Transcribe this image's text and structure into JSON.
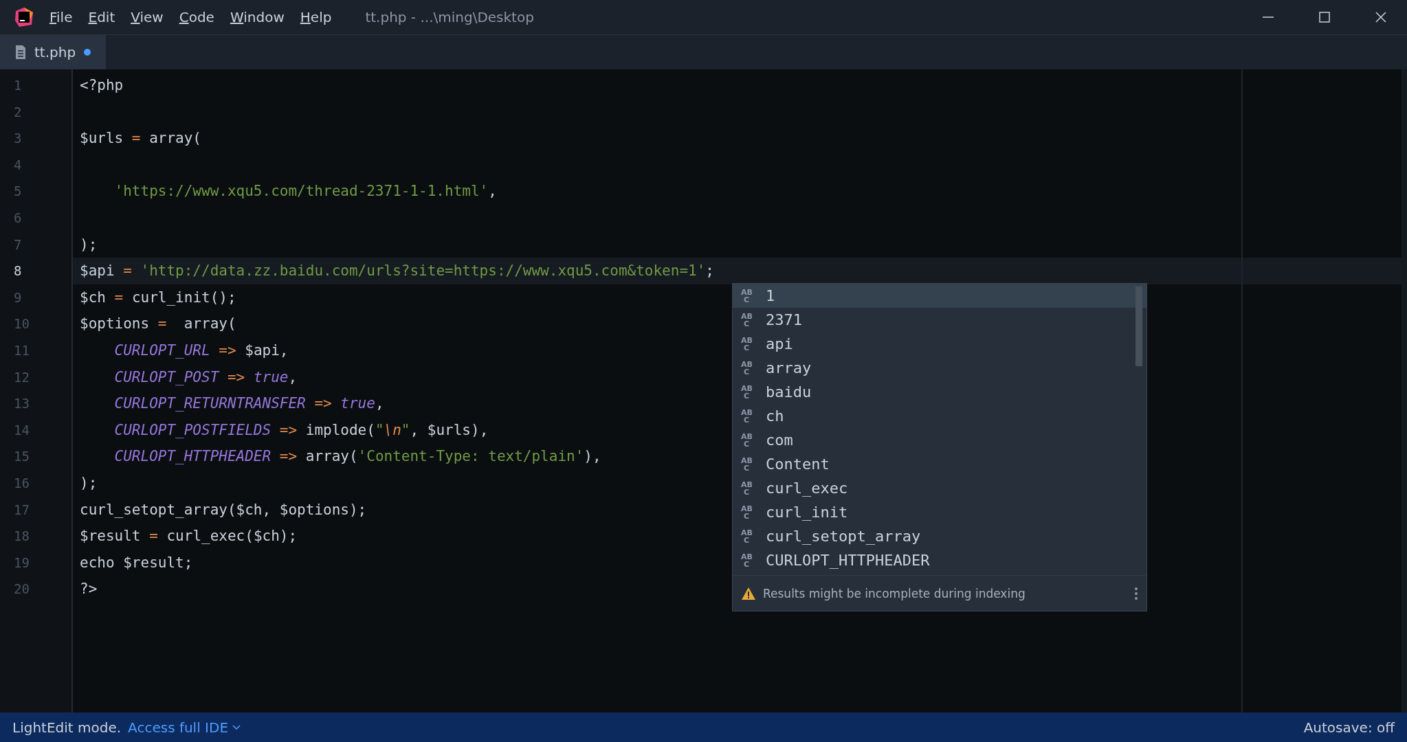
{
  "menu_bar": {
    "items": [
      "File",
      "Edit",
      "View",
      "Code",
      "Window",
      "Help"
    ],
    "title": "tt.php - ...\\ming\\Desktop"
  },
  "tabs": [
    {
      "label": "tt.php",
      "selected": true,
      "modified": true
    }
  ],
  "editor": {
    "lines": [
      {
        "number": "1",
        "current": false,
        "tokens": [
          {
            "kind": "plain",
            "text": "<?php"
          }
        ]
      },
      {
        "number": "2",
        "current": false
      },
      {
        "number": "3",
        "current": false,
        "tokens": [
          {
            "kind": "plain",
            "text": "$urls"
          },
          {
            "kind": "op",
            "text": " = "
          },
          {
            "kind": "plain",
            "text": "array("
          }
        ]
      },
      {
        "number": "4",
        "current": false
      },
      {
        "number": "5",
        "current": false,
        "tokens": [
          {
            "kind": "str",
            "text": "    'https://www.xqu5.com/thread-2371-1-1.html'"
          },
          {
            "kind": "plain",
            "text": ","
          }
        ]
      },
      {
        "number": "6",
        "current": false
      },
      {
        "number": "7",
        "current": false,
        "tokens": [
          {
            "kind": "plain",
            "text": ");"
          }
        ]
      },
      {
        "number": "8",
        "current": true,
        "tokens": [
          {
            "kind": "plain",
            "text": "$api"
          },
          {
            "kind": "op",
            "text": " = "
          },
          {
            "kind": "str",
            "text": "'http://data.zz.baidu.com/urls?site=https://www.xqu5.com&token=1'"
          },
          {
            "kind": "plain",
            "text": ";"
          }
        ]
      },
      {
        "number": "9",
        "current": false,
        "tokens": [
          {
            "kind": "plain",
            "text": "$ch"
          },
          {
            "kind": "op",
            "text": " = "
          },
          {
            "kind": "plain",
            "text": "curl_init();"
          }
        ]
      },
      {
        "number": "10",
        "current": false,
        "tokens": [
          {
            "kind": "plain",
            "text": "$options"
          },
          {
            "kind": "op",
            "text": " =  "
          },
          {
            "kind": "plain",
            "text": "array("
          }
        ]
      },
      {
        "number": "11",
        "current": false,
        "tokens": [
          {
            "kind": "const",
            "text": "    CURLOPT_URL"
          },
          {
            "kind": "op",
            "text": " => "
          },
          {
            "kind": "plain",
            "text": "$api,"
          }
        ]
      },
      {
        "number": "12",
        "current": false,
        "tokens": [
          {
            "kind": "const",
            "text": "    CURLOPT_POST"
          },
          {
            "kind": "op",
            "text": " => "
          },
          {
            "kind": "const",
            "text": "true"
          },
          {
            "kind": "plain",
            "text": ","
          }
        ]
      },
      {
        "number": "13",
        "current": false,
        "tokens": [
          {
            "kind": "const",
            "text": "    CURLOPT_RETURNTRANSFER"
          },
          {
            "kind": "op",
            "text": " => "
          },
          {
            "kind": "const",
            "text": "true"
          },
          {
            "kind": "plain",
            "text": ","
          }
        ]
      },
      {
        "number": "14",
        "current": false,
        "tokens": [
          {
            "kind": "const",
            "text": "    CURLOPT_POSTFIELDS"
          },
          {
            "kind": "op",
            "text": " => "
          },
          {
            "kind": "plain",
            "text": "implode("
          },
          {
            "kind": "str",
            "text": "\""
          },
          {
            "kind": "esc",
            "text": "\\n"
          },
          {
            "kind": "str",
            "text": "\""
          },
          {
            "kind": "plain",
            "text": ", $urls),"
          }
        ]
      },
      {
        "number": "15",
        "current": false,
        "tokens": [
          {
            "kind": "const",
            "text": "    CURLOPT_HTTPHEADER"
          },
          {
            "kind": "op",
            "text": " => "
          },
          {
            "kind": "plain",
            "text": "array("
          },
          {
            "kind": "str",
            "text": "'Content-Type: text/plain'"
          },
          {
            "kind": "plain",
            "text": "),"
          }
        ]
      },
      {
        "number": "16",
        "current": false,
        "tokens": [
          {
            "kind": "plain",
            "text": ");"
          }
        ]
      },
      {
        "number": "17",
        "current": false,
        "tokens": [
          {
            "kind": "plain",
            "text": "curl_setopt_array($ch, $options);"
          }
        ]
      },
      {
        "number": "18",
        "current": false,
        "tokens": [
          {
            "kind": "plain",
            "text": "$result"
          },
          {
            "kind": "op",
            "text": " = "
          },
          {
            "kind": "plain",
            "text": "curl_exec($ch);"
          }
        ]
      },
      {
        "number": "19",
        "current": false,
        "tokens": [
          {
            "kind": "plain",
            "text": "echo $result;"
          }
        ]
      },
      {
        "number": "20",
        "current": false,
        "tokens": [
          {
            "kind": "plain",
            "text": "?>"
          }
        ]
      }
    ]
  },
  "completion": {
    "items": [
      {
        "icon": [
          "AB",
          "C"
        ],
        "label": "1",
        "selected": true
      },
      {
        "icon": [
          "AB",
          "C"
        ],
        "label": "2371",
        "selected": false
      },
      {
        "icon": [
          "AB",
          "C"
        ],
        "label": "api",
        "selected": false
      },
      {
        "icon": [
          "AB",
          "C"
        ],
        "label": "array",
        "selected": false
      },
      {
        "icon": [
          "AB",
          "C"
        ],
        "label": "baidu",
        "selected": false
      },
      {
        "icon": [
          "AB",
          "C"
        ],
        "label": "ch",
        "selected": false
      },
      {
        "icon": [
          "AB",
          "C"
        ],
        "label": "com",
        "selected": false
      },
      {
        "icon": [
          "AB",
          "C"
        ],
        "label": "Content",
        "selected": false
      },
      {
        "icon": [
          "AB",
          "C"
        ],
        "label": "curl_exec",
        "selected": false
      },
      {
        "icon": [
          "AB",
          "C"
        ],
        "label": "curl_init",
        "selected": false
      },
      {
        "icon": [
          "AB",
          "C"
        ],
        "label": "curl_setopt_array",
        "selected": false
      },
      {
        "icon": [
          "AB",
          "C"
        ],
        "label": "CURLOPT_HTTPHEADER",
        "selected": false
      }
    ],
    "footer": "Results might be incomplete during indexing"
  },
  "status_bar": {
    "mode": "LightEdit mode.",
    "link": "Access full IDE",
    "autosave": "Autosave: off"
  }
}
